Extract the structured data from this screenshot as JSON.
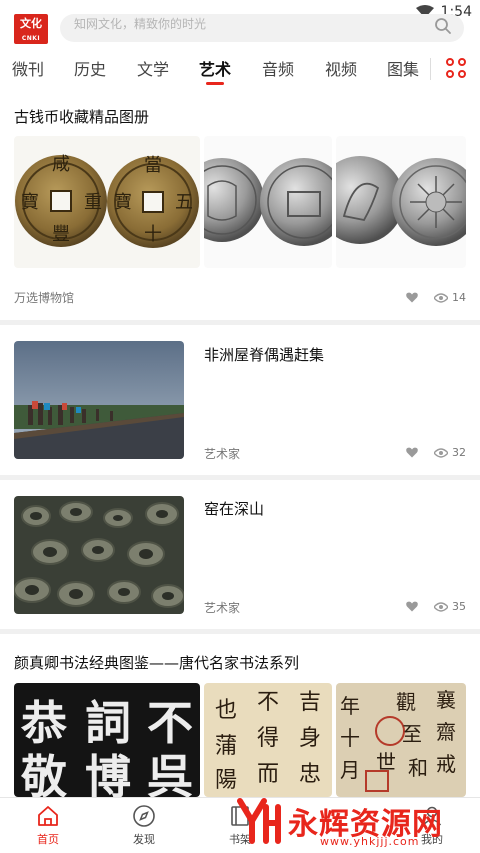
{
  "status_bar": {
    "time": "1:54"
  },
  "header": {
    "logo_text": "文化",
    "logo_sub": "CNKI",
    "search_placeholder": "知网文化，精致你的时光"
  },
  "tabs": [
    {
      "label": "微刊",
      "active": false
    },
    {
      "label": "历史",
      "active": false
    },
    {
      "label": "文学",
      "active": false
    },
    {
      "label": "艺术",
      "active": true
    },
    {
      "label": "音频",
      "active": false
    },
    {
      "label": "视频",
      "active": false
    },
    {
      "label": "图集",
      "active": false
    }
  ],
  "accent_color": "#e8261c",
  "feed": {
    "card1": {
      "title": "古钱币收藏精品图册",
      "source": "万选博物馆",
      "views": "14"
    },
    "card2": {
      "title": "非洲屋脊偶遇赶集",
      "source": "艺术家",
      "views": "32"
    },
    "card3": {
      "title": "窑在深山",
      "source": "艺术家",
      "views": "35"
    },
    "card4": {
      "title": "颜真卿书法经典图鉴——唐代名家书法系列",
      "calligraphy": {
        "img1": [
          "恭",
          "詞",
          "不",
          "敬",
          "博",
          "呉"
        ],
        "img2": [
          "也",
          "不",
          "吉",
          "蒲",
          "得",
          "身",
          "陽",
          "而",
          "忠"
        ],
        "img3": [
          "年",
          "觀",
          "襄",
          "十",
          "至",
          "齋",
          "月",
          "和",
          "戒",
          "世"
        ]
      }
    }
  },
  "bottom_nav": [
    {
      "label": "首页",
      "icon": "home-icon",
      "active": true
    },
    {
      "label": "发现",
      "icon": "compass-icon",
      "active": false
    },
    {
      "label": "书架",
      "icon": "book-icon",
      "active": false
    },
    {
      "label": "我的",
      "icon": "user-icon",
      "active": false
    }
  ],
  "watermark": {
    "text": "永辉资源网",
    "url": "www.yhkjjj.com"
  }
}
